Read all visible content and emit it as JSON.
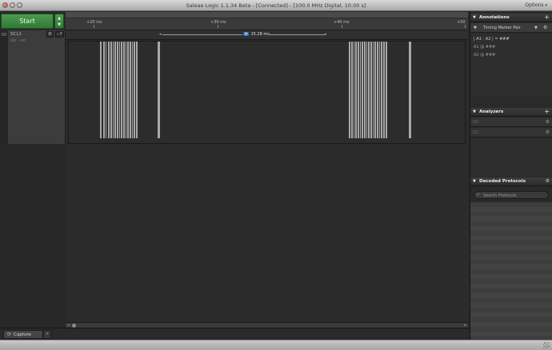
{
  "window": {
    "title": "Saleae Logic 1.1.34 Beta - [Connected] - [100.0 MHz Digital, 10.00 s]",
    "options_label": "Options",
    "options_caret": "▾"
  },
  "capture": {
    "start_label": "Start",
    "arrows_label": "▲\n▼"
  },
  "channel": {
    "number": "00",
    "name": "SCL1",
    "sub": "i2c - scl",
    "gear_icon": "⚙",
    "trigger_icon": "⌐F"
  },
  "ruler": {
    "ticks": [
      "+20 ms",
      "+30 ms",
      "+40 ms",
      "+50"
    ]
  },
  "marker": {
    "badge": "M",
    "label": "15.28 ms",
    "left_arrow": "◂",
    "right_arrow": "▸"
  },
  "waveform": {
    "color": "#a8a8a8",
    "background": "#2c2c2c"
  },
  "annotations": {
    "title": "Annotations",
    "add_icon": "+",
    "pair_label": "Timing Marker Pair",
    "measurements": [
      "| A1 - A2 | = ###",
      "A1  @  ###",
      "A2  @  ###"
    ]
  },
  "analyzers": {
    "title": "Analyzers",
    "add_icon": "+",
    "items": [
      "I2C",
      "I2C"
    ]
  },
  "decoded": {
    "title": "Decoded Protocols",
    "search_placeholder": "Search Protocols"
  },
  "bottom": {
    "capture_tab": "Capture",
    "more_tab": "»"
  }
}
